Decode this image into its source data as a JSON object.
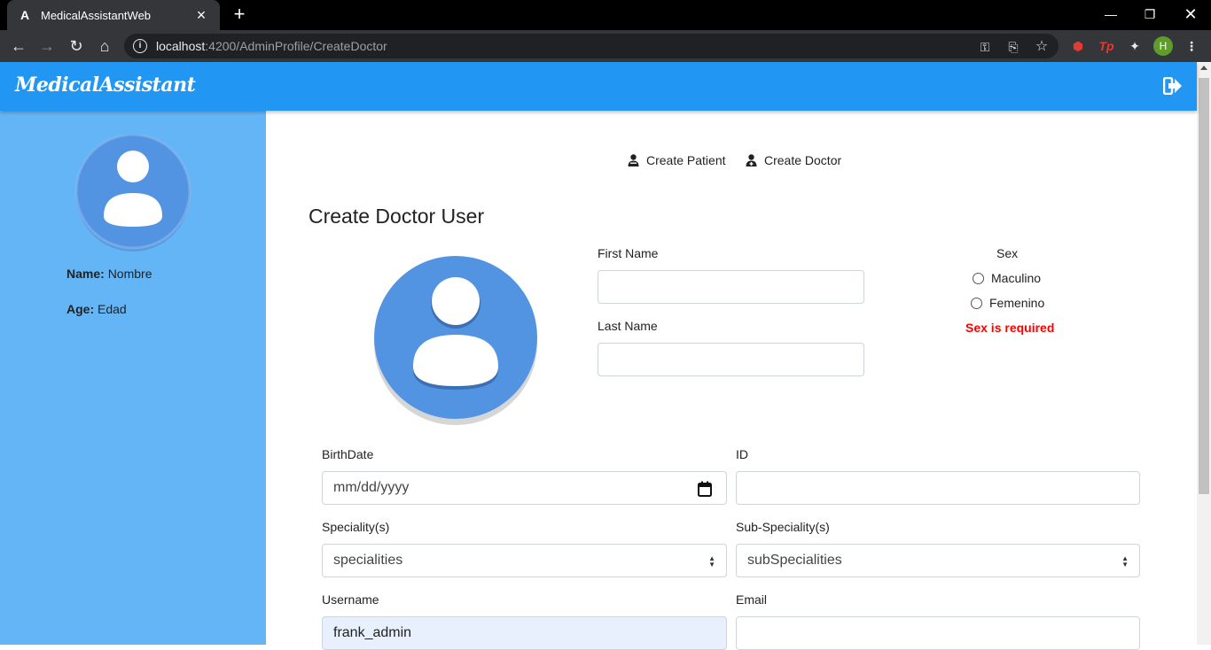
{
  "browser": {
    "tab_title": "MedicalAssistantWeb",
    "tab_favicon": "A",
    "new_tab": "+",
    "url_host": "localhost",
    "url_rest": ":4200/AdminProfile/CreateDoctor",
    "profile_initial": "H",
    "extension_tp": "Tp"
  },
  "header": {
    "brand": "MedicalAssistant"
  },
  "sidebar": {
    "name_label": "Name:",
    "name_value": "Nombre",
    "age_label": "Age:",
    "age_value": "Edad"
  },
  "nav_tabs": {
    "create_patient": "Create Patient",
    "create_doctor": "Create Doctor"
  },
  "form": {
    "title": "Create Doctor User",
    "first_name_label": "First Name",
    "last_name_label": "Last Name",
    "sex_label": "Sex",
    "sex_options": [
      "Maculino",
      "Femenino"
    ],
    "sex_error": "Sex is required",
    "birthdate_label": "BirthDate",
    "birthdate_placeholder": "mm/dd/yyyy",
    "id_label": "ID",
    "speciality_label": "Speciality(s)",
    "speciality_value": "specialities",
    "subspeciality_label": "Sub-Speciality(s)",
    "subspeciality_value": "subSpecialities",
    "username_label": "Username",
    "username_value": "frank_admin",
    "email_label": "Email"
  },
  "colors": {
    "header_blue": "#2196f3",
    "sidebar_blue": "#64b5f6",
    "avatar_blue": "#5294e2",
    "error_red": "#ff0000",
    "autofill_bg": "#e8f0fe"
  }
}
